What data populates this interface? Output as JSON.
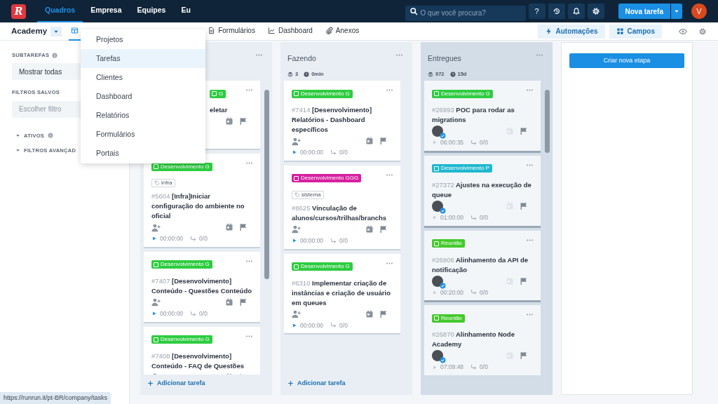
{
  "app": {
    "logo": "R"
  },
  "nav": [
    {
      "label": "Quadros",
      "selected": true
    },
    {
      "label": "Empresa",
      "selected": false
    },
    {
      "label": "Equipes",
      "selected": false
    },
    {
      "label": "Eu",
      "selected": false
    }
  ],
  "search": {
    "placeholder": "O que você procura?"
  },
  "help": "?",
  "new_task": "Nova tarefa",
  "user": {
    "initial": "V"
  },
  "board": {
    "name": "Academy"
  },
  "views": [
    {
      "kind": "board",
      "selected": true
    },
    {
      "kind": "form",
      "label": "Formulários",
      "selected": false
    },
    {
      "kind": "chart",
      "label": "Dashboard",
      "selected": false
    },
    {
      "kind": "attach",
      "label": "Anexos",
      "selected": false
    }
  ],
  "actions": [
    {
      "kind": "bolt",
      "label": "Automações"
    },
    {
      "kind": "grid",
      "label": "Campos"
    }
  ],
  "menu": [
    {
      "label": "Projetos",
      "selected": false
    },
    {
      "label": "Tarefas",
      "selected": true
    },
    {
      "label": "Clientes",
      "selected": false
    },
    {
      "label": "Dashboard",
      "selected": false
    },
    {
      "label": "Relatórios",
      "selected": false
    },
    {
      "label": "Formulários",
      "selected": false
    },
    {
      "label": "Portais",
      "selected": false
    }
  ],
  "sidebar": {
    "subtasks": {
      "label": "SUBTAREFAS",
      "value": "Mostrar todas"
    },
    "saved_filters": {
      "label": "FILTROS SALVOS",
      "placeholder": "Escolher filtro"
    },
    "sections": [
      {
        "label": "ATIVOS",
        "info": true,
        "expanded": true
      },
      {
        "label": "FILTROS AVANÇAD",
        "info": false,
        "expanded": true
      }
    ]
  },
  "columns": [
    {
      "final": false,
      "scrollable": true,
      "add_label": "Adicionar tarefa",
      "cards": [
        {
          "kind": "covered",
          "label": {
            "text": "G",
            "color": "#2ecc40"
          },
          "title": "eletar",
          "done": false
        },
        {
          "kind": "full",
          "label": {
            "text": "Desenvolvimento G",
            "color": "#2ecc40"
          },
          "tags": [
            "infra"
          ],
          "number": "#5604",
          "title": "[Infra]Iniciar configuração do ambiente no oficial",
          "assigned": false,
          "done": false,
          "timer": "00:00:00",
          "subtasks": "0/0"
        },
        {
          "kind": "full",
          "label": {
            "text": "Desenvolvimento G",
            "color": "#2ecc40"
          },
          "number": "#7407",
          "title": "[Desenvolvimento] Conteúdo - Questões Conteúdo",
          "assigned": false,
          "done": false,
          "timer": "00:00:00",
          "subtasks": "0/0"
        },
        {
          "kind": "full",
          "label": {
            "text": "Desenvolvimento G",
            "color": "#2ecc40"
          },
          "number": "#7408",
          "title": "[Desenvolvimento] Conteúdo - FAQ de Questões",
          "assigned": false,
          "done": false
        }
      ]
    },
    {
      "title": "Fazendo",
      "stats": {
        "count": "3",
        "time": "0min"
      },
      "final": false,
      "scrollable": false,
      "add_label": "Adicionar tarefa",
      "cards": [
        {
          "kind": "full",
          "label": {
            "text": "Desenvolvimento G",
            "color": "#2ecc40"
          },
          "number": "#7414",
          "title": "[Desenvolvimento] Relatórios - Dashboard específicos",
          "assigned": false,
          "done": false,
          "timer": "00:00:00",
          "subtasks": "0/0"
        },
        {
          "kind": "full",
          "label": {
            "text": "Desenvolvimento GGG",
            "color": "#d6209f"
          },
          "tags": [
            "sistema"
          ],
          "number": "#8625",
          "title": "Vinculação de alunos/cursos/trilhas/branchs",
          "assigned": false,
          "done": false,
          "timer": "00:00:00",
          "subtasks": "0/0"
        },
        {
          "kind": "full",
          "label": {
            "text": "Desenvolvimento G",
            "color": "#2ecc40"
          },
          "number": "#6310",
          "title": "Implementar criação de instâncias e criação de usuário em queues",
          "assigned": false,
          "done": false,
          "timer": "00:00:00",
          "subtasks": "0/0"
        }
      ]
    },
    {
      "title": "Entregues",
      "stats": {
        "count": "972",
        "time": "15d"
      },
      "final": true,
      "scrollable": true,
      "cards": [
        {
          "kind": "full",
          "label": {
            "text": "Desenvolvimento G",
            "color": "#2ecc40"
          },
          "number": "#26993",
          "title": "POC para rodar as migrations",
          "assigned": true,
          "done": true,
          "timer": "06:00:35",
          "subtasks": "0/0"
        },
        {
          "kind": "full",
          "label": {
            "text": "Desenvolvimento P",
            "color": "#20b8d0"
          },
          "number": "#27372",
          "title": "Ajustes na execução de queue",
          "assigned": true,
          "done": true,
          "timer": "01:00:00",
          "subtasks": "0/0"
        },
        {
          "kind": "full",
          "label": {
            "text": "Reunião",
            "color": "#44c92c"
          },
          "number": "#26906",
          "title": "Alinhamento da API de notificação",
          "assigned": true,
          "done": true,
          "timer": "00:20:00",
          "subtasks": "0/0"
        },
        {
          "kind": "full",
          "label": {
            "text": "Reunião",
            "color": "#44c92c"
          },
          "number": "#26870",
          "title": "Alinhamento Node Academy",
          "assigned": true,
          "done": true,
          "timer": "07:09:48",
          "subtasks": "0/0"
        }
      ]
    }
  ],
  "new_stage": "Criar nova etapa",
  "status_bar": {
    "url": "https://runrun.it/pt-BR/company/tasks"
  }
}
